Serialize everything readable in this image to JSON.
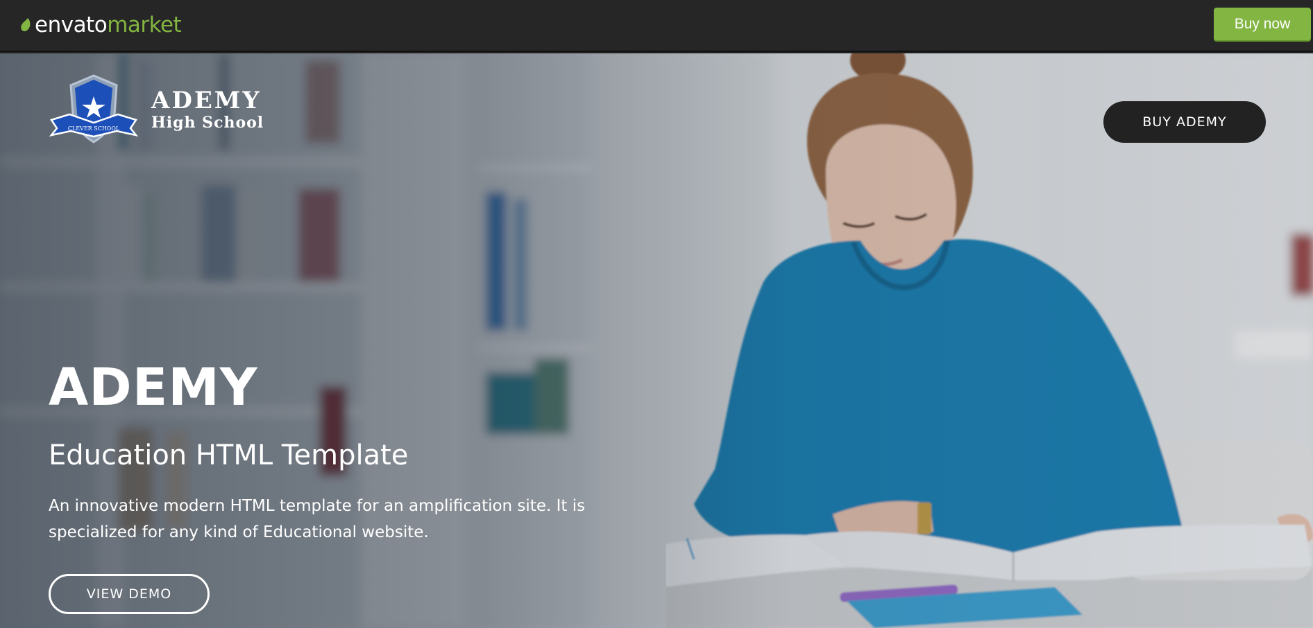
{
  "envato": {
    "logo_word1": "envato",
    "logo_word2": "market",
    "buy_now_label": "Buy now",
    "brand_color": "#82b541"
  },
  "hero": {
    "school_name": "ADEMY",
    "school_subtitle": "High School",
    "crest_ribbon": "CLEVER SCHOOL",
    "buy_button_label": "BUY  ADEMY",
    "title": "ADEMY",
    "subtitle": "Education HTML Template",
    "description": "An innovative modern HTML template for an amplification site. It is specialized for any kind of Educational website.",
    "view_demo_label": "VIEW DEMO",
    "crest_color": "#1d4fb8"
  }
}
